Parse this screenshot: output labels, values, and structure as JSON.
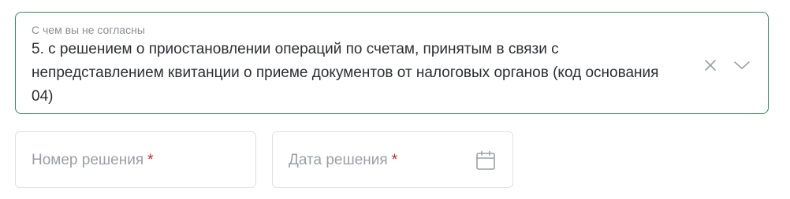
{
  "disagreement_select": {
    "label": "С чем вы не согласны",
    "value": "5. с решением о приостановлении операций по счетам, принятым в связи с непредставлением квитанции о приеме документов от налоговых органов (код основания 04)",
    "clear_icon": "close-icon",
    "expand_icon": "chevron-down-icon"
  },
  "decision_number": {
    "placeholder": "Номер решения",
    "required_mark": "*"
  },
  "decision_date": {
    "placeholder": "Дата решения",
    "required_mark": "*",
    "icon": "calendar-icon"
  },
  "colors": {
    "active_border": "#2f8a5a",
    "inactive_border": "#dde0e3",
    "required": "#d11f3a",
    "text": "#2b2f33",
    "muted": "#9a9fa5"
  }
}
